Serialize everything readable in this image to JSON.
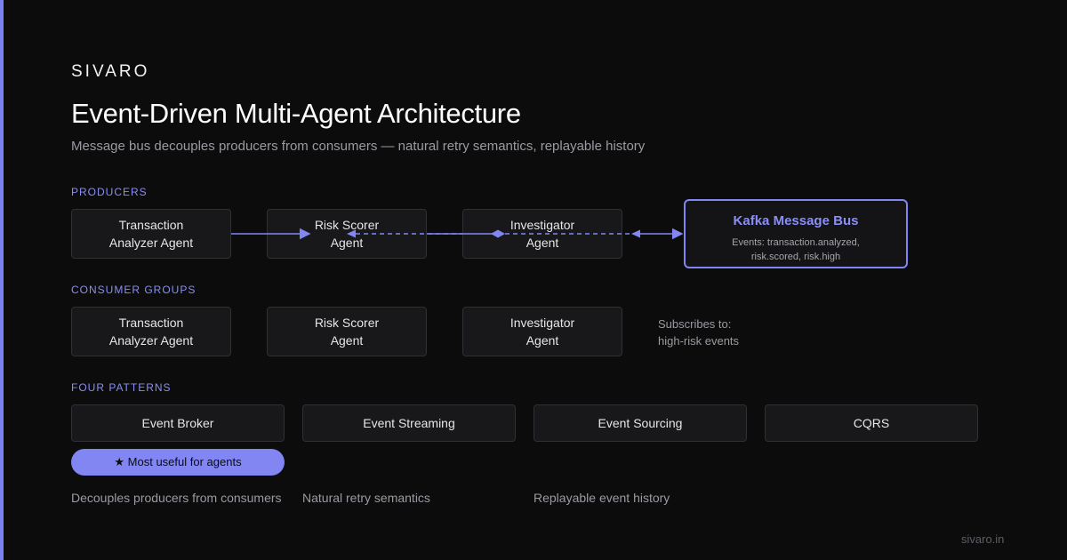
{
  "brand": "SIVARO",
  "title": "Event-Driven Multi-Agent Architecture",
  "subtitle": "Message bus decouples producers from consumers — natural retry semantics, replayable history",
  "producers": {
    "label": "PRODUCERS",
    "agents": [
      "Transaction\nAnalyzer Agent",
      "Risk Scorer\nAgent",
      "Investigator\nAgent"
    ]
  },
  "bus": {
    "title": "Kafka Message Bus",
    "events": "Events: transaction.analyzed,\nrisk.scored, risk.high"
  },
  "consumers": {
    "label": "CONSUMER GROUPS",
    "agents": [
      "Transaction\nAnalyzer Agent",
      "Risk Scorer\nAgent",
      "Investigator\nAgent"
    ],
    "note": "Subscribes to:\nhigh-risk events"
  },
  "patterns": {
    "label": "FOUR PATTERNS",
    "items": [
      "Event Broker",
      "Event Streaming",
      "Event Sourcing",
      "CQRS"
    ],
    "badge": "★ Most useful for agents",
    "descriptions": [
      "Decouples producers from consumers",
      "Natural retry semantics",
      "Replayable event history"
    ]
  },
  "footer": "sivaro.in",
  "colors": {
    "accent": "#8286f3",
    "background": "#0c0c0d",
    "box": "#18181b"
  }
}
